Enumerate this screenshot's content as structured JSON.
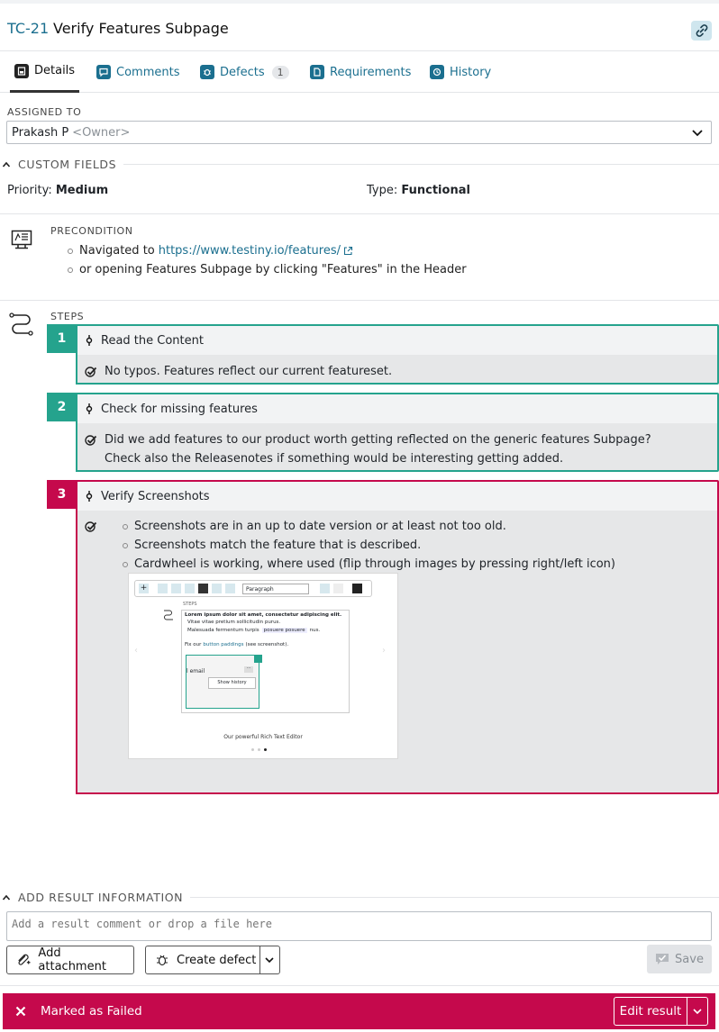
{
  "header": {
    "case_id": "TC-21",
    "title": "Verify Features Subpage"
  },
  "tabs": [
    {
      "label": "Details",
      "icon": "details-icon",
      "active": true
    },
    {
      "label": "Comments",
      "icon": "comment-icon"
    },
    {
      "label": "Defects",
      "icon": "bug-icon",
      "badge": "1"
    },
    {
      "label": "Requirements",
      "icon": "document-icon"
    },
    {
      "label": "History",
      "icon": "history-icon"
    }
  ],
  "assigned": {
    "label": "ASSIGNED TO",
    "value": "Prakash P",
    "role": "<Owner>"
  },
  "custom_fields": {
    "heading": "CUSTOM FIELDS",
    "priority_label": "Priority:",
    "priority_value": "Medium",
    "type_label": "Type:",
    "type_value": "Functional"
  },
  "precondition": {
    "label": "PRECONDITION",
    "line1_text": "Navigated to",
    "line1_link": "https://www.testiny.io/features/",
    "line2": "or opening Features Subpage by clicking \"Features\" in the Header"
  },
  "steps": {
    "label": "STEPS",
    "items": [
      {
        "num": "1",
        "action": "Read the Content",
        "expected": [
          "No typos. Features reflect our current featureset."
        ],
        "status": "passed"
      },
      {
        "num": "2",
        "action": "Check for missing features",
        "expected": [
          "Did we add features to our product worth getting reflected on the generic features Subpage?",
          "Check also the Releasenotes if something would be interesting getting added."
        ],
        "status": "passed"
      },
      {
        "num": "3",
        "action": "Verify Screenshots",
        "expected_bullets": [
          "Screenshots are in an up to date version or at least not too old.",
          "Screenshots match the feature that is described.",
          "Cardwheel is working, where used (flip through images by pressing right/left icon)"
        ],
        "status": "failed"
      }
    ]
  },
  "embedded_screenshot": {
    "toolbar_paragraph": "Paragraph",
    "steps_label": "STEPS",
    "bold_line": "Lorem ipsum dolor sit amet, consectetur adipiscing elit.",
    "bullet1": "Vitae vitae pretium sollicitudin purus.",
    "bullet2_start": "Malesuada fermentum turpis",
    "bullet2_chip": "posuere posuere",
    "bullet2_end": "nus.",
    "fix_text_start": "Fix our",
    "fix_link": "button paddings",
    "fix_text_end": "(see screenshot).",
    "email_text": "l email",
    "show_history": "Show history",
    "caption": "Our powerful Rich Text Editor"
  },
  "result": {
    "heading": "ADD RESULT INFORMATION",
    "comment_placeholder": "Add a result comment or drop a file here",
    "add_attachment": "Add attachment",
    "create_defect": "Create defect",
    "save": "Save"
  },
  "status": {
    "text": "Marked as Failed",
    "edit": "Edit result"
  },
  "colors": {
    "accent": "#1b6f8f",
    "passed": "#25a38d",
    "failed": "#c5094c"
  }
}
